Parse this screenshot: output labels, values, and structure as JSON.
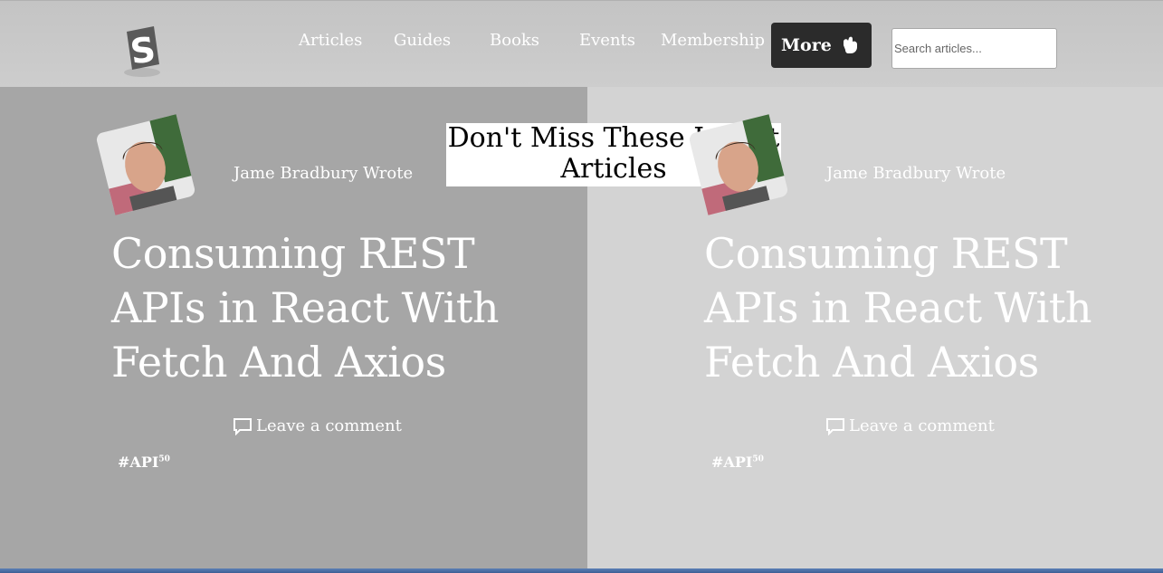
{
  "header": {
    "logo_icon": "smashing-s-logo",
    "nav": [
      "Articles",
      "Guides",
      "Books",
      "Events",
      "Membership"
    ],
    "more_label": "More",
    "more_icon": "hand-pointer-icon",
    "search_placeholder": "Search articles..."
  },
  "section_title": "Don't Miss These Latest Articles",
  "cards": [
    {
      "author_line": "Jame Bradbury Wrote",
      "title": "Consuming REST APIs in React With Fetch And Axios",
      "comment_label": "Leave a comment",
      "tag": "#API",
      "tag_sup": "50"
    },
    {
      "author_line": "Jame Bradbury Wrote",
      "title": "Consuming REST APIs in React With Fetch And Axios",
      "comment_label": "Leave a comment",
      "tag": "#API",
      "tag_sup": "50"
    }
  ],
  "colors": {
    "left_panel": "#a6a6a6",
    "right_panel": "#d3d3d3",
    "header_bg": "#c8c8c8",
    "more_button": "#2b2b2b"
  }
}
